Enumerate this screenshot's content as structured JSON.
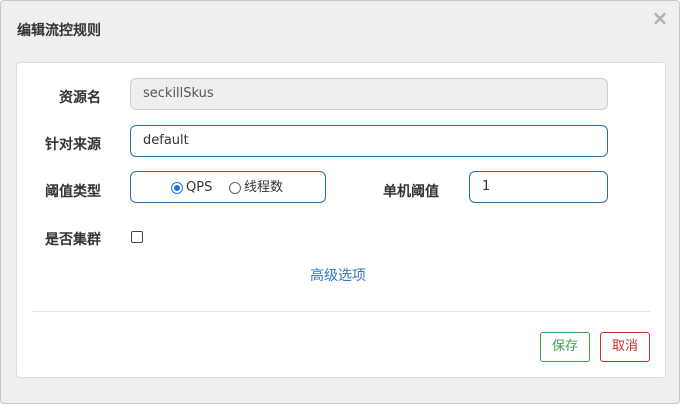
{
  "dialog": {
    "title": "编辑流控规则",
    "close_glyph": "×"
  },
  "form": {
    "resource_label": "资源名",
    "resource_value": "seckillSkus",
    "origin_label": "针对来源",
    "origin_value": "default",
    "threshold_type_label": "阈值类型",
    "threshold_type_options": [
      "QPS",
      "线程数"
    ],
    "threshold_type_selected": "QPS",
    "single_threshold_label": "单机阈值",
    "single_threshold_value": "1",
    "cluster_label": "是否集群",
    "cluster_checked": false,
    "advanced_link": "高级选项"
  },
  "footer": {
    "save_label": "保存",
    "cancel_label": "取消"
  },
  "colors": {
    "primary_border": "#2a70a8",
    "link": "#337ab7",
    "save": "#3aa24a",
    "cancel": "#c9302c"
  }
}
